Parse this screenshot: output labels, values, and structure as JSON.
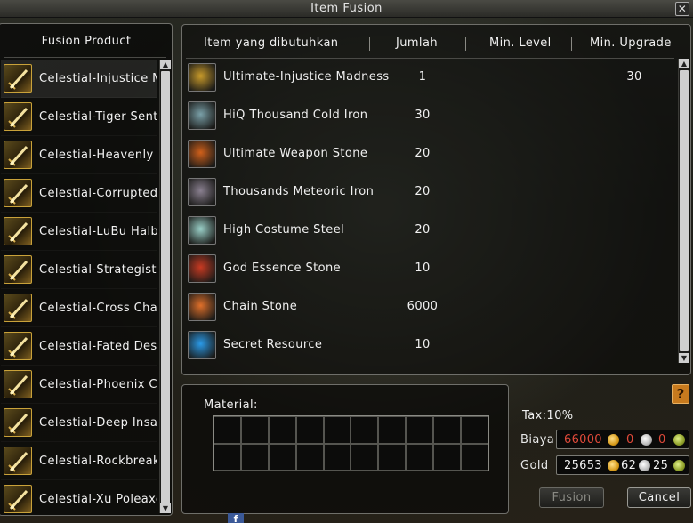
{
  "window": {
    "title": "Item Fusion",
    "close_label": "✕"
  },
  "left_panel": {
    "header": "Fusion Product",
    "items": [
      {
        "label": "Celestial-Injustice Mad",
        "icon": "sword-icon",
        "selected": true
      },
      {
        "label": "Celestial-Tiger Sentim",
        "icon": "sword-icon",
        "selected": false
      },
      {
        "label": "Celestial-Heavenly Sw",
        "icon": "sword-icon",
        "selected": false
      },
      {
        "label": "Celestial-Corrupted W",
        "icon": "sword-icon",
        "selected": false
      },
      {
        "label": "Celestial-LuBu Halberd",
        "icon": "halberd-icon",
        "selected": false
      },
      {
        "label": "Celestial-Strategist Ve",
        "icon": "sword-icon",
        "selected": false
      },
      {
        "label": "Celestial-Cross Charge",
        "icon": "sword-icon",
        "selected": false
      },
      {
        "label": "Celestial-Fated Destru",
        "icon": "sword-icon",
        "selected": false
      },
      {
        "label": "Celestial-Phoenix Chain",
        "icon": "chain-icon",
        "selected": false
      },
      {
        "label": "Celestial-Deep Insanity",
        "icon": "sword-icon",
        "selected": false
      },
      {
        "label": "Celestial-Rockbreaker",
        "icon": "sword-icon",
        "selected": false
      },
      {
        "label": "Celestial-Xu Poleaxe",
        "icon": "poleaxe-icon",
        "selected": false
      }
    ]
  },
  "requirements": {
    "columns": {
      "item": "Item yang dibutuhkan",
      "qty": "Jumlah",
      "min_level": "Min. Level",
      "min_upgrade": "Min. Upgrade"
    },
    "rows": [
      {
        "item": "Ultimate-Injustice Madness",
        "qty": "1",
        "min_level": "",
        "min_upgrade": "30",
        "icon": "sword-icon",
        "color": "#c89a2a"
      },
      {
        "item": "HiQ Thousand Cold Iron",
        "qty": "30",
        "min_level": "",
        "min_upgrade": "",
        "icon": "ore-icon",
        "color": "#7aa0a8"
      },
      {
        "item": "Ultimate Weapon Stone",
        "qty": "20",
        "min_level": "",
        "min_upgrade": "",
        "icon": "fire-stone-icon",
        "color": "#d0601a"
      },
      {
        "item": "Thousands Meteoric Iron",
        "qty": "20",
        "min_level": "",
        "min_upgrade": "",
        "icon": "meteor-iron-icon",
        "color": "#8a8090"
      },
      {
        "item": "High Costume Steel",
        "qty": "20",
        "min_level": "",
        "min_upgrade": "",
        "icon": "steel-icon",
        "color": "#9ad0c8"
      },
      {
        "item": "God Essence Stone",
        "qty": "10",
        "min_level": "",
        "min_upgrade": "",
        "icon": "essence-stone-icon",
        "color": "#c83a22"
      },
      {
        "item": "Chain Stone",
        "qty": "6000",
        "min_level": "",
        "min_upgrade": "",
        "icon": "chain-stone-icon",
        "color": "#e0702a"
      },
      {
        "item": "Secret Resource",
        "qty": "10",
        "min_level": "",
        "min_upgrade": "",
        "icon": "crystal-icon",
        "color": "#2a9ae8"
      }
    ]
  },
  "material": {
    "label": "Material:",
    "slots": 20
  },
  "cost": {
    "help_label": "?",
    "tax": "Tax:10%",
    "biaya": {
      "label": "Biaya",
      "gold": "66000",
      "silver": "0",
      "bronze": "0",
      "gold_color": "#e04a3a",
      "other_color": "#e04a3a"
    },
    "gold": {
      "label": "Gold",
      "gold": "25653",
      "silver": "62",
      "bronze": "25",
      "gold_color": "#f0f0f0",
      "other_color": "#f0f0f0"
    }
  },
  "buttons": {
    "fusion": "Fusion",
    "cancel": "Cancel"
  },
  "facebook_label": "f"
}
